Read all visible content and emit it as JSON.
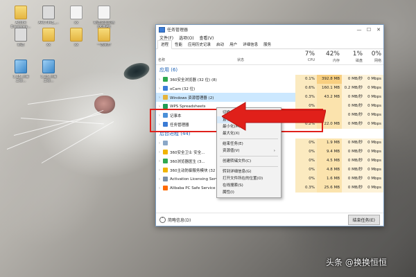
{
  "desktop": {
    "icons": [
      {
        "label": "Adobe\nDreamwe...",
        "kind": "folder"
      },
      {
        "label": "ARCTIME_...",
        "kind": "exe"
      },
      {
        "label": "xx",
        "kind": "doc"
      },
      {
        "label": "新建文本文档\n(未命名)",
        "kind": "doc"
      },
      {
        "label": "新建",
        "kind": "exe"
      },
      {
        "label": "xx",
        "kind": "folder"
      },
      {
        "label": "xx",
        "kind": "folder"
      },
      {
        "label": "一念花开",
        "kind": "folder"
      },
      {
        "label": "1.25·上海\n工资...",
        "kind": "tile"
      },
      {
        "label": "1.25·上海\n工资...",
        "kind": "tile"
      }
    ]
  },
  "taskmanager": {
    "title": "任务管理器",
    "controls": {
      "min": "—",
      "max": "☐",
      "close": "✕"
    },
    "menu": [
      "文件(F)",
      "选项(O)",
      "查看(V)"
    ],
    "tabs": [
      "进程",
      "性能",
      "应用历史记录",
      "启动",
      "用户",
      "详细信息",
      "服务"
    ],
    "columns": {
      "name": "名称",
      "status": "状态",
      "cpu_pct": "7%",
      "cpu_label": "CPU",
      "mem_pct": "42%",
      "mem_label": "内存",
      "disk_pct": "1%",
      "disk_label": "磁盘",
      "net_pct": "0%",
      "net_label": "网络"
    },
    "groups": {
      "apps": "应用 (6)",
      "background": "后台进程 (44)"
    },
    "app_rows": [
      {
        "name": "360安全浏览器 (32 位) (8)",
        "cpu": "0.1%",
        "mem": "392.8 MB",
        "disk": "0 MB/秒",
        "net": "0 Mbps",
        "icon_color": "#2fa84f"
      },
      {
        "name": "oCam (32 位)",
        "cpu": "0.6%",
        "mem": "160.1 MB",
        "disk": "0.2 MB/秒",
        "net": "0 Mbps",
        "icon_color": "#3c7dd9"
      },
      {
        "name": "Windows 资源管理器 (2)",
        "cpu": "0.3%",
        "mem": "43.2 MB",
        "disk": "0 MB/秒",
        "net": "0 Mbps",
        "icon_color": "#e5b33b"
      },
      {
        "name": "WPS Spreadsheets",
        "cpu": "0%",
        "mem": "",
        "disk": "0 MB/秒",
        "net": "0 Mbps",
        "icon_color": "#1f9d55"
      },
      {
        "name": "记事本",
        "cpu": "0%",
        "mem": "",
        "disk": "0 MB/秒",
        "net": "0 Mbps",
        "icon_color": "#4a8fd8"
      },
      {
        "name": "任务管理器",
        "cpu": "0.2%",
        "mem": "22.0 MB",
        "disk": "0 MB/秒",
        "net": "0 Mbps",
        "icon_color": "#3a7bd5"
      }
    ],
    "bg_rows": [
      {
        "name": "",
        "cpu": "0%",
        "mem": "1.9 MB",
        "disk": "0 MB/秒",
        "net": "0 Mbps",
        "icon_color": "#8aa7c7"
      },
      {
        "name": "360安全卫士 安全...",
        "cpu": "0%",
        "mem": "9.4 MB",
        "disk": "0 MB/秒",
        "net": "0 Mbps",
        "icon_color": "#f0b400"
      },
      {
        "name": "360浏览器医生 (3...",
        "cpu": "0%",
        "mem": "4.5 MB",
        "disk": "0 MB/秒",
        "net": "0 Mbps",
        "icon_color": "#2fa84f"
      },
      {
        "name": "360主动防御服务模块 (32 位)",
        "cpu": "0%",
        "mem": "4.8 MB",
        "disk": "0 MB/秒",
        "net": "0 Mbps",
        "icon_color": "#f0b400"
      },
      {
        "name": "Activation Licensing Service",
        "cpu": "0%",
        "mem": "1.6 MB",
        "disk": "0 MB/秒",
        "net": "0 Mbps",
        "icon_color": "#7a8fa8"
      },
      {
        "name": "Alibaba PC Safe Service (32...",
        "cpu": "0.3%",
        "mem": "25.6 MB",
        "disk": "0 MB/秒",
        "net": "0 Mbps",
        "icon_color": "#ff6a00"
      }
    ],
    "footer": {
      "fewer_details": "简略信息(D)",
      "end_task": "结束任务(E)"
    }
  },
  "context_menu": {
    "items": [
      {
        "label": "切换(S)",
        "highlight": false,
        "submenu": false
      },
      {
        "label": "置于前端(B)",
        "highlight": true,
        "submenu": false
      },
      {
        "label": "最小化(M)",
        "highlight": false,
        "submenu": false
      },
      {
        "label": "最大化(X)",
        "highlight": false,
        "submenu": false
      },
      {
        "sep": true
      },
      {
        "label": "结束任务(E)",
        "highlight": false,
        "submenu": false
      },
      {
        "label": "资源值(V)",
        "highlight": false,
        "submenu": true
      },
      {
        "sep": true
      },
      {
        "label": "创建转储文件(C)",
        "highlight": false,
        "submenu": false
      },
      {
        "sep": true
      },
      {
        "label": "转到详细信息(G)",
        "highlight": false,
        "submenu": false
      },
      {
        "label": "打开文件所在的位置(O)",
        "highlight": false,
        "submenu": false
      },
      {
        "label": "在线搜索(S)",
        "highlight": false,
        "submenu": false
      },
      {
        "label": "属性(I)",
        "highlight": false,
        "submenu": false
      }
    ]
  },
  "annotation": {
    "color": "#e0201a"
  },
  "watermark": "头条 @换换恒恒"
}
